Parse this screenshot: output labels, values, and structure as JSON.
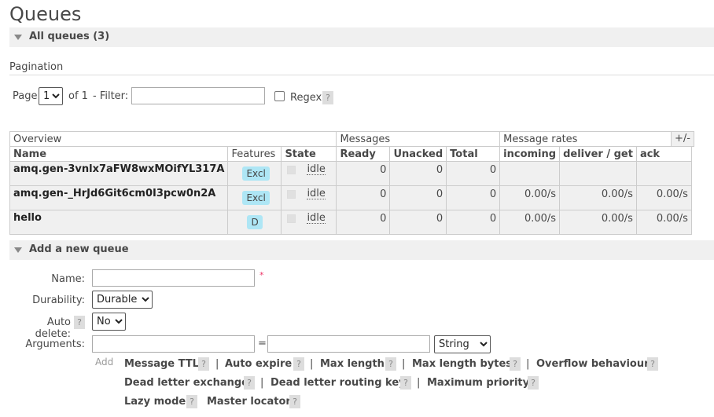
{
  "page_title": "Queues",
  "all_queues_label": "All queues (3)",
  "pagination": {
    "label": "Pagination",
    "page_label": "Page",
    "page_value": "1",
    "of_label": "of 1",
    "filter_label": "- Filter:",
    "filter_value": "",
    "regex_label": "Regex",
    "help": "?"
  },
  "table": {
    "groups": [
      "Overview",
      "Messages",
      "Message rates"
    ],
    "toggle": "+/-",
    "columns": [
      "Name",
      "Features",
      "State",
      "Ready",
      "Unacked",
      "Total",
      "incoming",
      "deliver / get",
      "ack"
    ],
    "rows": [
      {
        "name": "amq.gen-3vnlx7aFW8wxMOifYL317A",
        "feature": "Excl",
        "state": "idle",
        "ready": "0",
        "unacked": "0",
        "total": "0",
        "incoming": "",
        "deliver": "",
        "ack": ""
      },
      {
        "name": "amq.gen-_HrJd6Git6cm0I3pcw0n2A",
        "feature": "Excl",
        "state": "idle",
        "ready": "0",
        "unacked": "0",
        "total": "0",
        "incoming": "0.00/s",
        "deliver": "0.00/s",
        "ack": "0.00/s"
      },
      {
        "name": "hello",
        "feature": "D",
        "state": "idle",
        "ready": "0",
        "unacked": "0",
        "total": "0",
        "incoming": "0.00/s",
        "deliver": "0.00/s",
        "ack": "0.00/s"
      }
    ]
  },
  "add_queue": {
    "title": "Add a new queue",
    "name_label": "Name:",
    "name_value": "",
    "required_mark": "*",
    "durability_label": "Durability:",
    "durability_value": "Durable",
    "auto_delete_label": "Auto delete:",
    "auto_delete_value": "No",
    "arguments_label": "Arguments:",
    "equals": "=",
    "arg_type": "String",
    "add_label": "Add",
    "help": "?",
    "separator": "|",
    "args_line1": [
      "Message TTL",
      "Auto expire",
      "Max length",
      "Max length bytes",
      "Overflow behaviour"
    ],
    "args_line2": [
      "Dead letter exchange",
      "Dead letter routing key",
      "Maximum priority"
    ],
    "args_line3": [
      "Lazy mode",
      "Master locator"
    ]
  }
}
